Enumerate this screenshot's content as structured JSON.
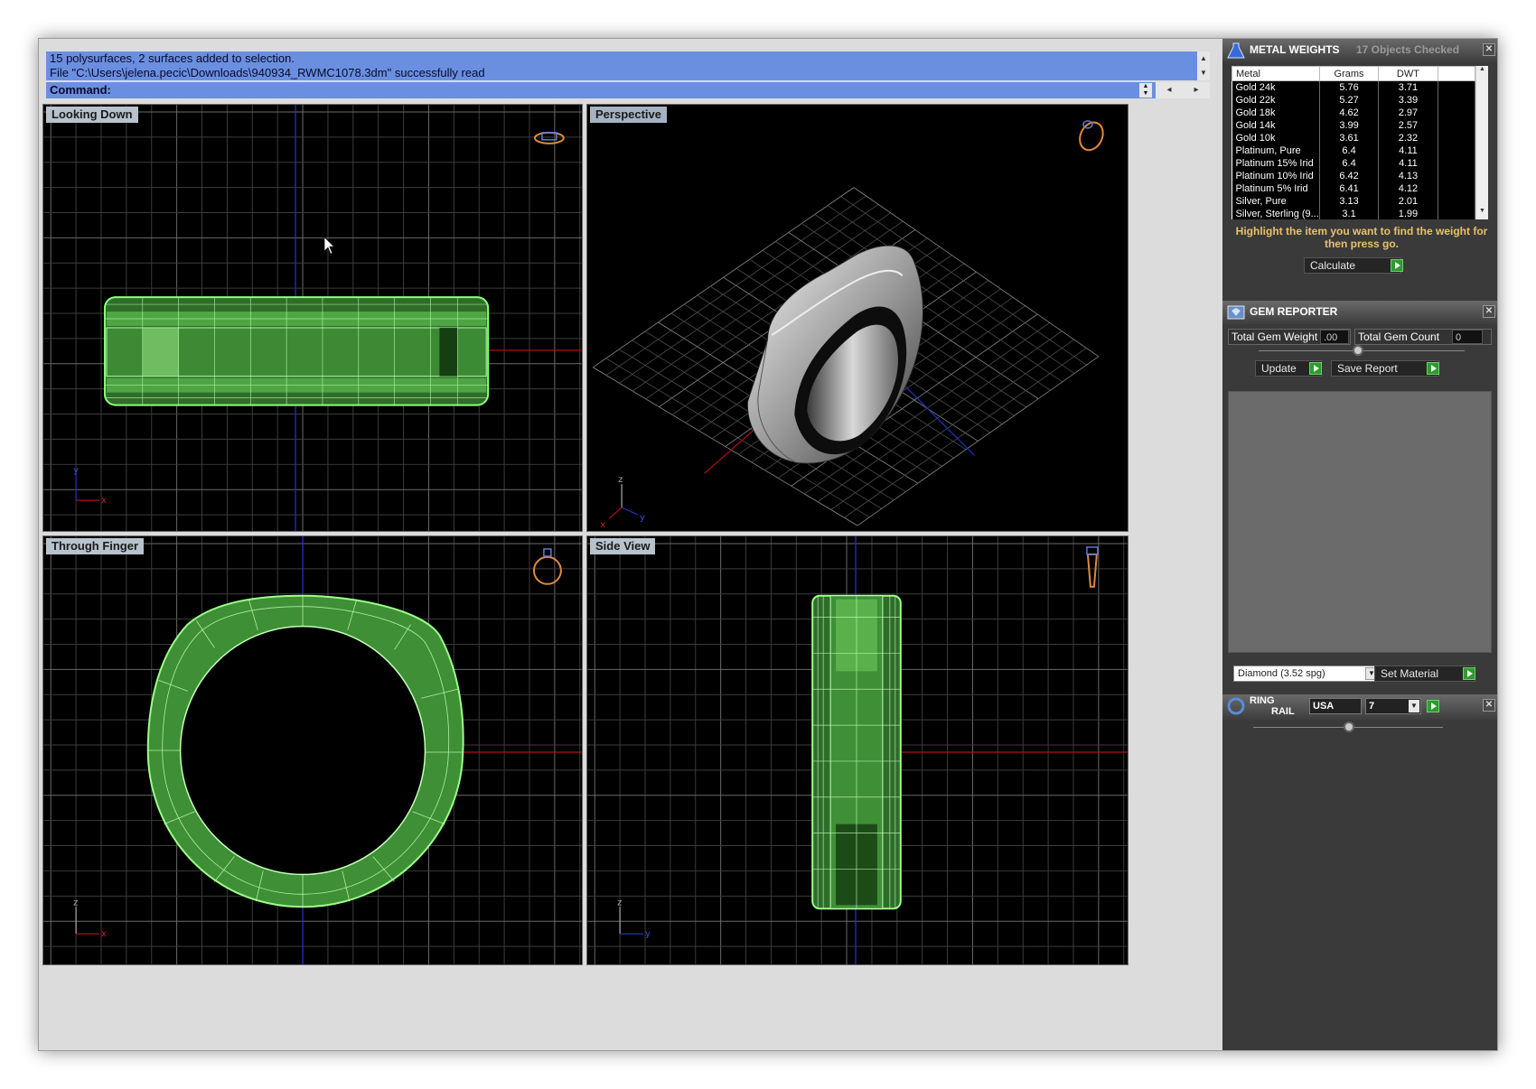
{
  "command": {
    "history": [
      "15 polysurfaces, 2 surfaces added to selection.",
      "File \"C:\\Users\\jelena.pecic\\Downloads\\940934_RWMC1078.3dm\" successfully read"
    ],
    "prompt": "Command:"
  },
  "viewports": {
    "top": {
      "label": "Looking Down",
      "axis_a": "y",
      "axis_b": "x"
    },
    "perspective": {
      "label": "Perspective",
      "axis_a": "z",
      "axis_b": "x",
      "axis_c": "y"
    },
    "front": {
      "label": "Through Finger",
      "axis_a": "z",
      "axis_b": "x"
    },
    "side": {
      "label": "Side View",
      "axis_a": "z",
      "axis_b": "y"
    }
  },
  "metal_weights": {
    "title": "METAL WEIGHTS",
    "status": "17 Objects Checked",
    "columns": [
      "Metal",
      "Grams",
      "DWT"
    ],
    "rows": [
      [
        "Gold 24k",
        "5.76",
        "3.71"
      ],
      [
        "Gold 22k",
        "5.27",
        "3.39"
      ],
      [
        "Gold 18k",
        "4.62",
        "2.97"
      ],
      [
        "Gold 14k",
        "3.99",
        "2.57"
      ],
      [
        "Gold 10k",
        "3.61",
        "2.32"
      ],
      [
        "Platinum, Pure",
        "6.4",
        "4.11"
      ],
      [
        "Platinum 15% Irid",
        "6.4",
        "4.11"
      ],
      [
        "Platinum 10% Irid",
        "6.42",
        "4.13"
      ],
      [
        "Platinum 5% Irid",
        "6.41",
        "4.12"
      ],
      [
        "Silver, Pure",
        "3.13",
        "2.01"
      ],
      [
        "Silver, Sterling (9...",
        "3.1",
        "1.99"
      ]
    ],
    "note": "Highlight the item you want to find the weight for then press go.",
    "calculate_label": "Calculate"
  },
  "gem_reporter": {
    "title": "GEM REPORTER",
    "total_weight_label": "Total Gem Weight",
    "total_weight_value": ".00",
    "total_count_label": "Total Gem Count",
    "total_count_value": "0",
    "update_label": "Update",
    "save_report_label": "Save Report",
    "material_selected": "Diamond    (3.52 spg)",
    "set_material_label": "Set Material"
  },
  "ring_rail": {
    "title_line1": "RING",
    "title_line2": "RAIL",
    "standard": "USA",
    "size": "7"
  },
  "colors": {
    "wire_green": "#7dff6a",
    "axis_red": "#b01010",
    "axis_blue": "#2030c0",
    "accent_orange": "#e8c26a"
  }
}
